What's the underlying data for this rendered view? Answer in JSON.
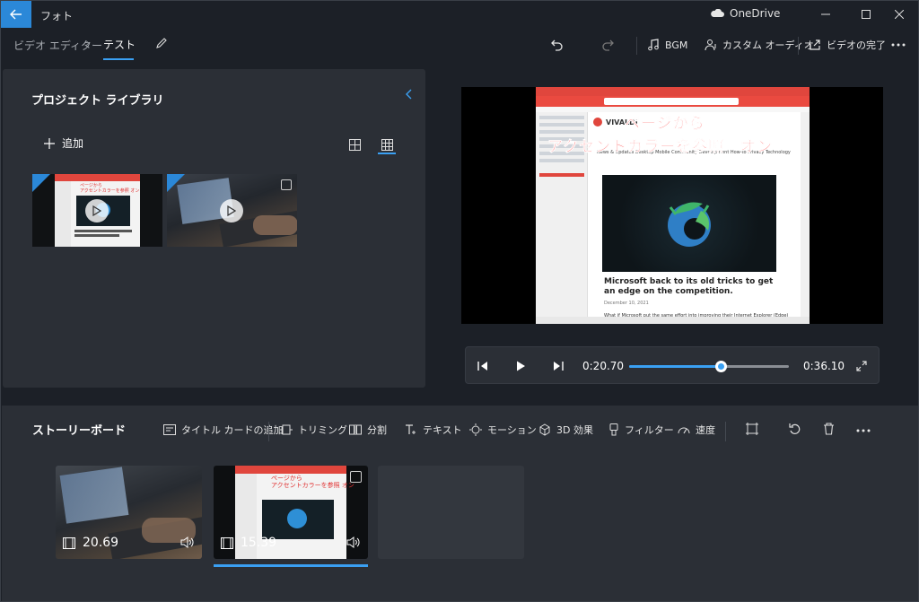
{
  "titlebar": {
    "app_title": "フォト",
    "cloud_label": "OneDrive"
  },
  "breadcrumb": {
    "parent": "ビデオ エディター",
    "separator": "›",
    "current": "テスト"
  },
  "toolbar": {
    "bgm_label": "BGM",
    "custom_audio_label": "カスタム オーディオ",
    "finish_label": "ビデオの完了"
  },
  "library": {
    "title": "プロジェクト ライブラリ",
    "add_label": "追加"
  },
  "preview": {
    "overlay_line1": "ページから",
    "overlay_line2": "アクセントカラーを参照　オン",
    "brand": "VIVALDI",
    "nav_text": "News & Updates   Desktop   Mobile   Community   Development   How-to   Privacy   Technology",
    "article_title": "Microsoft back to its old tricks to get an edge on the competition.",
    "article_date": "December 10, 2021",
    "article_text": "What if Microsoft put the same effort into improving their Internet Explorer (Edge) browser as"
  },
  "playback": {
    "current_time": "0:20.70",
    "total_time": "0:36.10",
    "progress": 0.573
  },
  "storyboard": {
    "title": "ストーリーボード",
    "tools": {
      "title_card": "タイトル カードの追加",
      "trim": "トリミング",
      "split": "分割",
      "text": "テキスト",
      "motion": "モーション",
      "effects_3d": "3D 効果",
      "filter": "フィルター",
      "speed": "速度"
    },
    "clips": [
      {
        "duration": "20.69"
      },
      {
        "duration": "15.39"
      }
    ]
  },
  "colors": {
    "accent": "#3aa0f3",
    "back_button": "#2b88d8",
    "panel": "#2b2f36",
    "background": "#1c2027"
  }
}
